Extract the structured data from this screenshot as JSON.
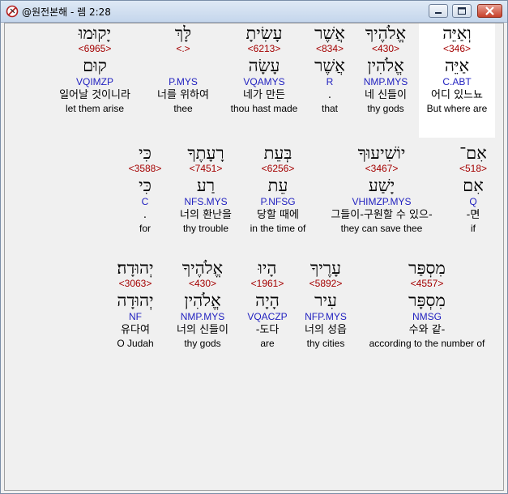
{
  "window": {
    "title": "@원전본해 - 렘 2:28"
  },
  "lines": [
    {
      "words": [
        {
          "heb": "וְאַיֵּה",
          "strong": "<346>",
          "lemma": "אַיֵּה",
          "morph": "C.ABT",
          "kor": "어디 있느뇨",
          "eng": "But where are",
          "highlight": true
        },
        {
          "heb": "אֱלֹהֶיךָ",
          "strong": "<430>",
          "lemma": "אֱלֹהִין",
          "morph": "NMP.MYS",
          "kor": "네 신들이",
          "eng": "thy gods"
        },
        {
          "heb": "אֲשֶׁר",
          "strong": "<834>",
          "lemma": "אֲשֶׁר",
          "morph": "R",
          "kor": ".",
          "eng": "that"
        },
        {
          "heb": "עָשִׂיתָ",
          "strong": "<6213>",
          "lemma": "עָשָׂה",
          "morph": "VQAMYS",
          "kor": "네가 만든",
          "eng": "thou hast made"
        },
        {
          "heb": "לָּךְ",
          "strong": "<.>",
          "lemma": "",
          "morph": "P.MYS",
          "kor": "너를 위하여",
          "eng": "thee"
        },
        {
          "heb": "יָקוּמוּ",
          "strong": "<6965>",
          "lemma": "קוּם",
          "morph": "VQIMZP",
          "kor": "일어날 것이니라",
          "eng": "let them arise"
        }
      ]
    },
    {
      "words": [
        {
          "heb": "אִם־",
          "strong": "<518>",
          "lemma": "אִם",
          "morph": "Q",
          "kor": "-면",
          "eng": "if"
        },
        {
          "heb": "יוֹשִׁיעוּךָ",
          "strong": "<3467>",
          "lemma": "יָשַׁע",
          "morph": "VHIMZP.MYS",
          "kor": "그들이-구원할 수 있으-",
          "eng": "they can save thee"
        },
        {
          "heb": "בְּעֵת",
          "strong": "<6256>",
          "lemma": "עֵת",
          "morph": "P.NFSG",
          "kor": "당할 때에",
          "eng": "in the time of"
        },
        {
          "heb": "רָעָתֶךָ",
          "strong": "<7451>",
          "lemma": "רַע",
          "morph": "NFS.MYS",
          "kor": "너의 환난을",
          "eng": "thy trouble"
        },
        {
          "heb": "כִּי",
          "strong": "<3588>",
          "lemma": "כִּי",
          "morph": "C",
          "kor": ".",
          "eng": "for"
        }
      ]
    },
    {
      "words": [
        {
          "heb": "מִסְפַּר",
          "strong": "<4557>",
          "lemma": "מִסְפָּר",
          "morph": "NMSG",
          "kor": "수와 같-",
          "eng": "according to the number of"
        },
        {
          "heb": "עָרֶיךָ",
          "strong": "<5892>",
          "lemma": "עִיר",
          "morph": "NFP.MYS",
          "kor": "너의 성읍",
          "eng": "thy cities"
        },
        {
          "heb": "הָיוּ",
          "strong": "<1961>",
          "lemma": "הָיָה",
          "morph": "VQACZP",
          "kor": "-도다",
          "eng": "are"
        },
        {
          "heb": "אֱלֹהֶיךָ",
          "strong": "<430>",
          "lemma": "אֱלֹהִין",
          "morph": "NMP.MYS",
          "kor": "너의 신들이",
          "eng": "thy gods"
        },
        {
          "heb": "יְהוּדָה׃",
          "strong": "<3063>",
          "lemma": "יְהוּדָה",
          "morph": "NF",
          "kor": "유다여",
          "eng": "O Judah"
        }
      ]
    }
  ]
}
